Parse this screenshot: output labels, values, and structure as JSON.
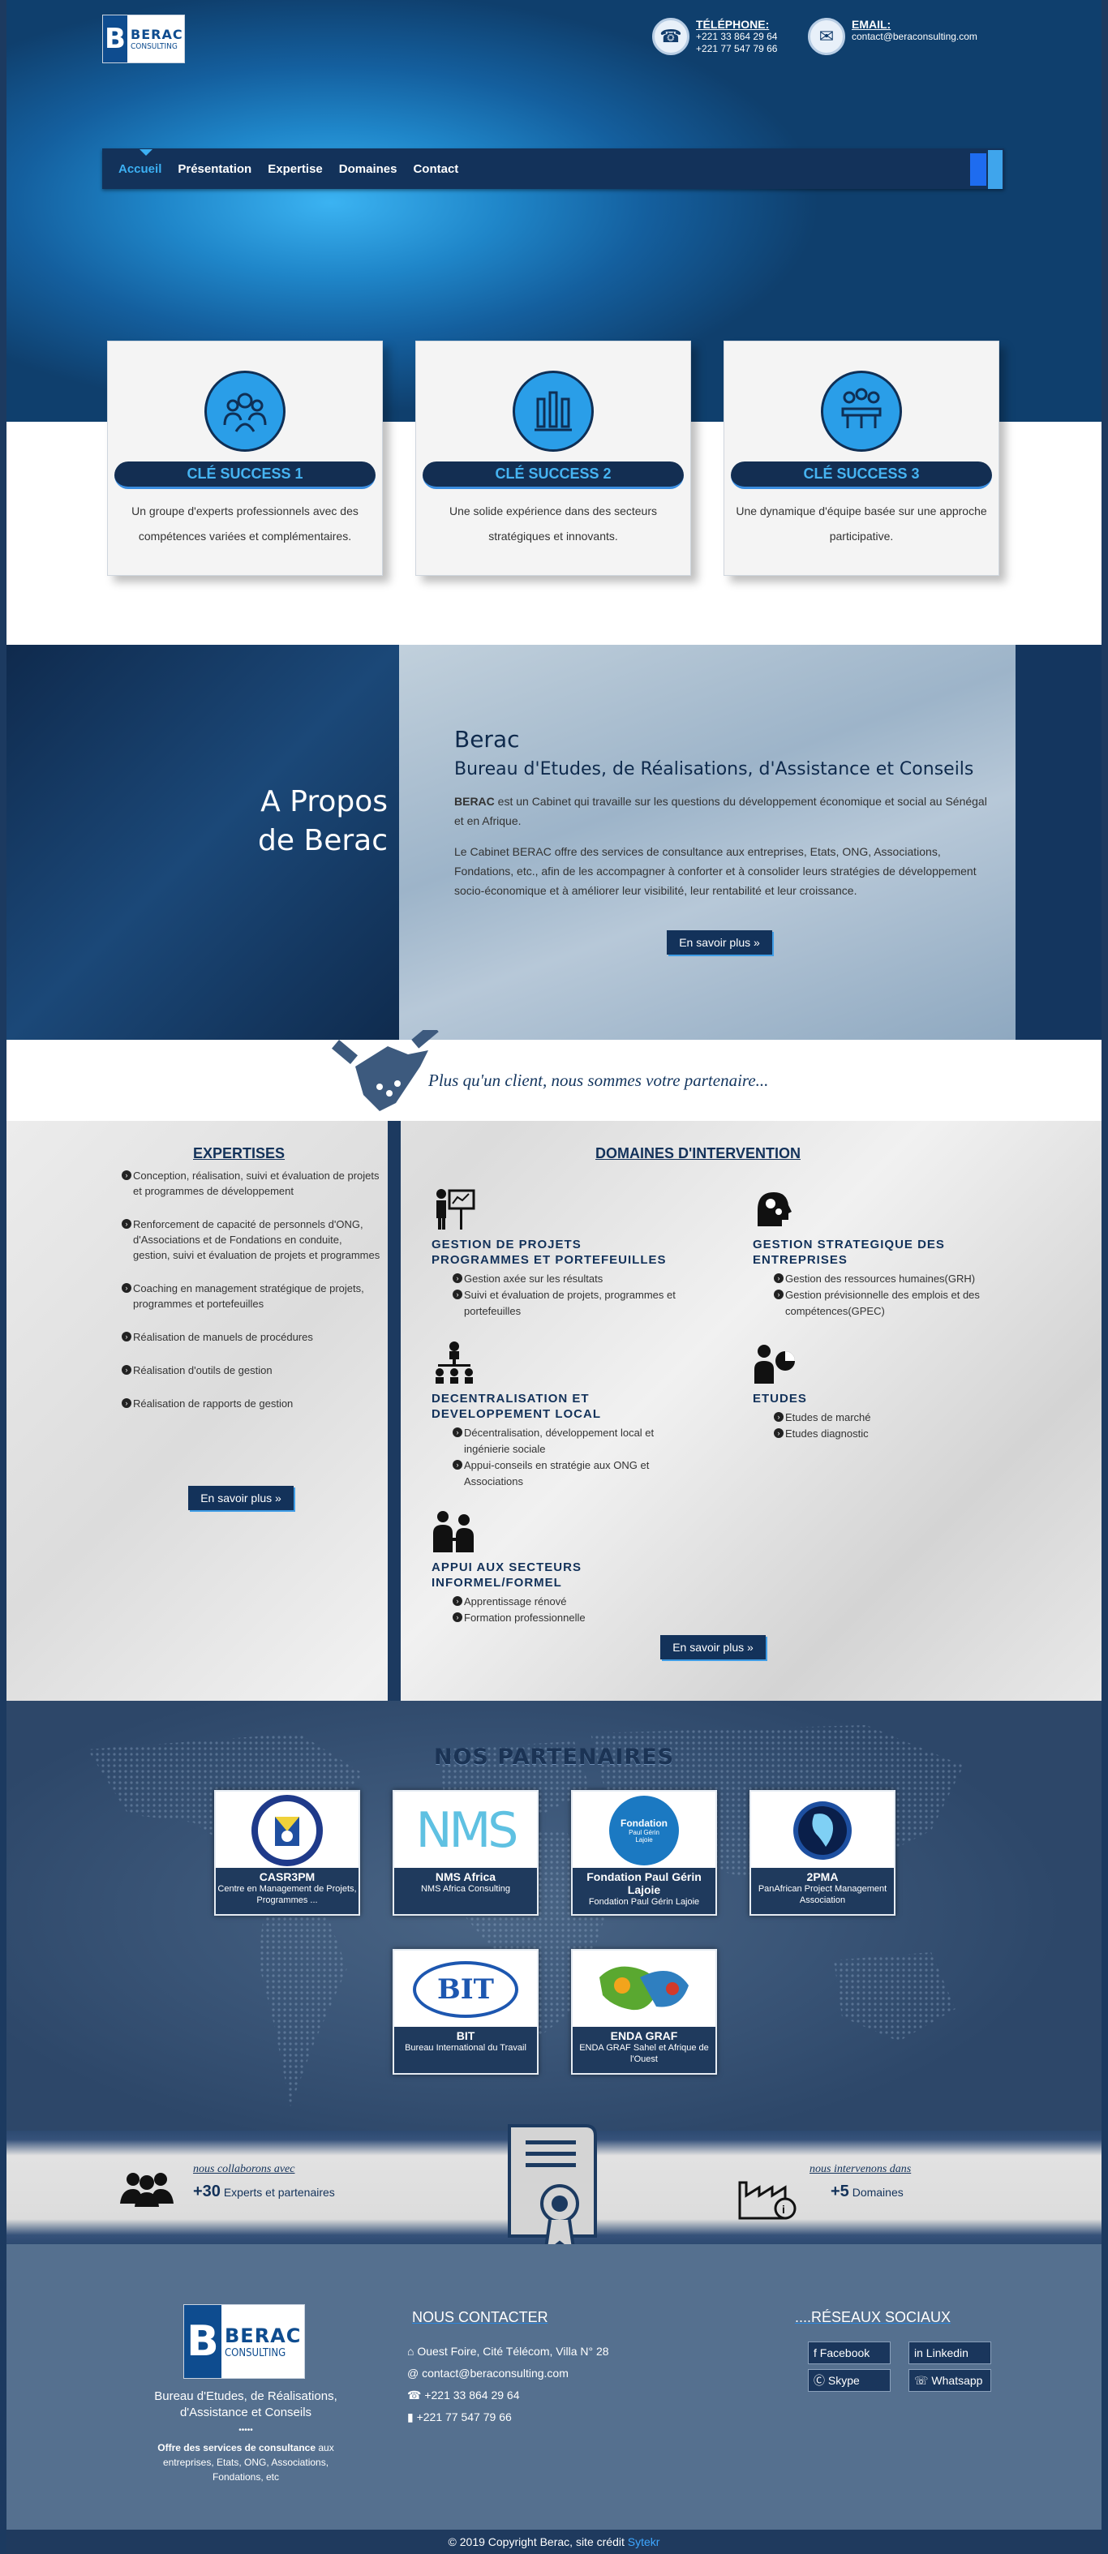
{
  "header": {
    "logo_brand": "BERAC",
    "logo_sub": "CONSULTING",
    "phone_label": "TÉLÉPHONE:",
    "phone_1": "+221 33 864 29 64",
    "phone_2": "+221 77 547 79 66",
    "email_label": "EMAIL:",
    "email": "contact@beraconsulting.com"
  },
  "nav": {
    "items": [
      {
        "label": "Accueil",
        "active": true
      },
      {
        "label": "Présentation"
      },
      {
        "label": "Expertise"
      },
      {
        "label": "Domaines"
      },
      {
        "label": "Contact"
      }
    ]
  },
  "success_cards": [
    {
      "title": "CLÉ SUCCESS 1",
      "desc": "Un groupe d'experts professionnels avec des compétences variées et complémentaires.",
      "icon": "team-care-icon"
    },
    {
      "title": "CLÉ SUCCESS 2",
      "desc": "Une solide expérience dans des secteurs stratégiques et innovants.",
      "icon": "raised-hands-icon"
    },
    {
      "title": "CLÉ SUCCESS 3",
      "desc": "Une dynamique d'équipe basée sur une approche participative.",
      "icon": "meeting-table-icon"
    }
  ],
  "about": {
    "heading": "A Propos de Berac",
    "title": "Berac",
    "subtitle": "Bureau d'Etudes, de Réalisations, d'Assistance et Conseils",
    "p1_bold": "BERAC",
    "p1_rest": " est un Cabinet qui travaille sur les questions du développement économique et social au Sénégal et en Afrique.",
    "p2": "Le Cabinet BERAC offre des services de consultance aux entreprises, Etats, ONG, Associations, Fondations, etc., afin de les accompagner à conforter et à consolider leurs stratégies de développement socio-économique et à améliorer leur visibilité, leur rentabilité et leur croissance.",
    "more": "En savoir plus »"
  },
  "slogan": "Plus qu'un client, nous sommes votre partenaire...",
  "expertises": {
    "title": "EXPERTISES",
    "items": [
      "Conception, réalisation, suivi et évaluation de projets et programmes de développement",
      "Renforcement de capacité de personnels d'ONG, d'Associations et de Fondations en conduite, gestion, suivi et évaluation de projets et programmes",
      "Coaching en management stratégique de projets, programmes et portefeuilles",
      "Réalisation de manuels de procédures",
      "Réalisation d'outils de gestion",
      "Réalisation de rapports de gestion"
    ],
    "more": "En savoir plus »"
  },
  "domaines": {
    "title": "DOMAINES D'INTERVENTION",
    "items": [
      {
        "title": "GESTION DE PROJETS PROGRAMMES ET PORTEFEUILLES",
        "bullets": [
          "Gestion axée sur les résultats",
          "Suivi et évaluation de projets, programmes et portefeuilles"
        ]
      },
      {
        "title": "GESTION STRATEGIQUE DES ENTREPRISES",
        "bullets": [
          "Gestion des ressources humaines(GRH)",
          "Gestion prévisionnelle des emplois et des compétences(GPEC)"
        ]
      },
      {
        "title": "DECENTRALISATION ET DEVELOPPEMENT LOCAL",
        "bullets": [
          "Décentralisation, développement local et ingénierie sociale",
          "Appui-conseils en stratégie aux ONG et Associations"
        ]
      },
      {
        "title": "ETUDES",
        "bullets": [
          "Etudes de marché",
          "Etudes diagnostic"
        ]
      },
      {
        "title": "APPUI AUX SECTEURS INFORMEL/FORMEL",
        "bullets": [
          "Apprentissage rénové",
          "Formation professionnelle"
        ]
      }
    ],
    "more": "En savoir plus »"
  },
  "partners": {
    "title": "NOS PARTENAIRES",
    "items": [
      {
        "name": "CASR3PM",
        "desc": "Centre en Management de Projets, Programmes ..."
      },
      {
        "name": "NMS Africa",
        "desc": "NMS Africa Consulting"
      },
      {
        "name": "Fondation Paul Gérin Lajoie",
        "desc": "Fondation Paul Gérin Lajoie"
      },
      {
        "name": "2PMA",
        "desc": "PanAfrican Project Management Association"
      },
      {
        "name": "BIT",
        "desc": "Bureau International du Travail"
      },
      {
        "name": "ENDA GRAF",
        "desc": "ENDA GRAF Sahel et Afrique de l'Ouest"
      }
    ],
    "logo_texts": {
      "nms": "NMS",
      "bit": "BIT",
      "fondation": "Fondation",
      "fondation_sub": "Paul Gérin Lajoie"
    }
  },
  "stats": {
    "left_caption": "nous collaborons avec",
    "left_number": "+30",
    "left_text": " Experts et partenaires",
    "right_caption": "nous intervenons dans",
    "right_number": "+5",
    "right_text": " Domaines"
  },
  "footer": {
    "company": "Bureau d'Etudes, de Réalisations, d'Assistance et Conseils",
    "dots": "•••••",
    "offer_bold": "Offre des services de consultance",
    "offer_rest": " aux entreprises, Etats, ONG, Associations, Fondations, etc",
    "contact_title": "NOUS CONTACTER",
    "address": "Ouest Foire, Cité Télécom, Villa N° 28",
    "email": "contact@beraconsulting.com",
    "phone": "+221 33 864 29 64",
    "mobile": "+221 77 547 79 66",
    "social_title": "....RÉSEAUX SOCIAUX",
    "socials": [
      "Facebook",
      "Linkedin",
      "Skype",
      "Whatsapp"
    ],
    "copyright": "© 2019 Copyright Berac, site crédit ",
    "credit": "Sytekr"
  },
  "colors": {
    "navy": "#13325a",
    "accent": "#3cb0f3",
    "footer": "#55708f"
  }
}
